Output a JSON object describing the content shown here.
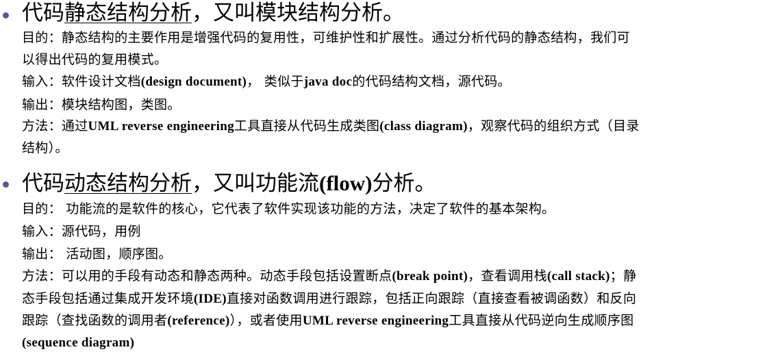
{
  "section1": {
    "heading_pre": "代码",
    "heading_underlined": "静态结构分析",
    "heading_post": "，又叫模块结构分析。",
    "purpose_line1": "目的：静态结构的主要作用是增强代码的复用性，可维护性和扩展性。通过分析代码的静态结构，我们可",
    "purpose_line2": "以得出代码的复用模式。",
    "input_a": "输入：软件设计文档",
    "input_b": "(design document)",
    "input_c": "， 类似于",
    "input_d": "java doc",
    "input_e": "的代码结构文档，源代码。",
    "output": "输出：模块结构图，类图。",
    "method_a": "方法：通过",
    "method_b": "UML reverse engineering",
    "method_c": "工具直接从代码生成类图",
    "method_d": "(class diagram)",
    "method_e": "，观察代码的组织方式（目录",
    "method_line2": "结构）。"
  },
  "section2": {
    "heading_pre": "代码",
    "heading_underlined": "动态结构分析",
    "heading_post_a": "，又叫功能流",
    "heading_post_b": "(flow)",
    "heading_post_c": "分析。",
    "purpose": "目的： 功能流的是软件的核心，它代表了软件实现该功能的方法，决定了软件的基本架构。",
    "input": "输入：源代码，用例",
    "output": "输出： 活动图，顺序图。",
    "method1_a": "方法：可以用的手段有动态和静态两种。动态手段包括设置断点",
    "method1_b": "(break point)",
    "method1_c": "，查看调用栈",
    "method1_d": "(call stack)",
    "method1_e": "；静",
    "method2_a": "态手段包括通过集成开发环境",
    "method2_b": "(IDE)",
    "method2_c": "直接对函数调用进行跟踪，包括正向跟踪（直接查看被调函数）和反向",
    "method3_a": "跟踪（查找函数的调用者",
    "method3_b": "(reference)",
    "method3_c": "），或者使用",
    "method3_d": "UML reverse engineering",
    "method3_e": "工具直接从代码逆向生成顺序图",
    "method4": "(sequence diagram)"
  },
  "colors": {
    "bullet": "#6a4c9c",
    "text": "#000000"
  }
}
